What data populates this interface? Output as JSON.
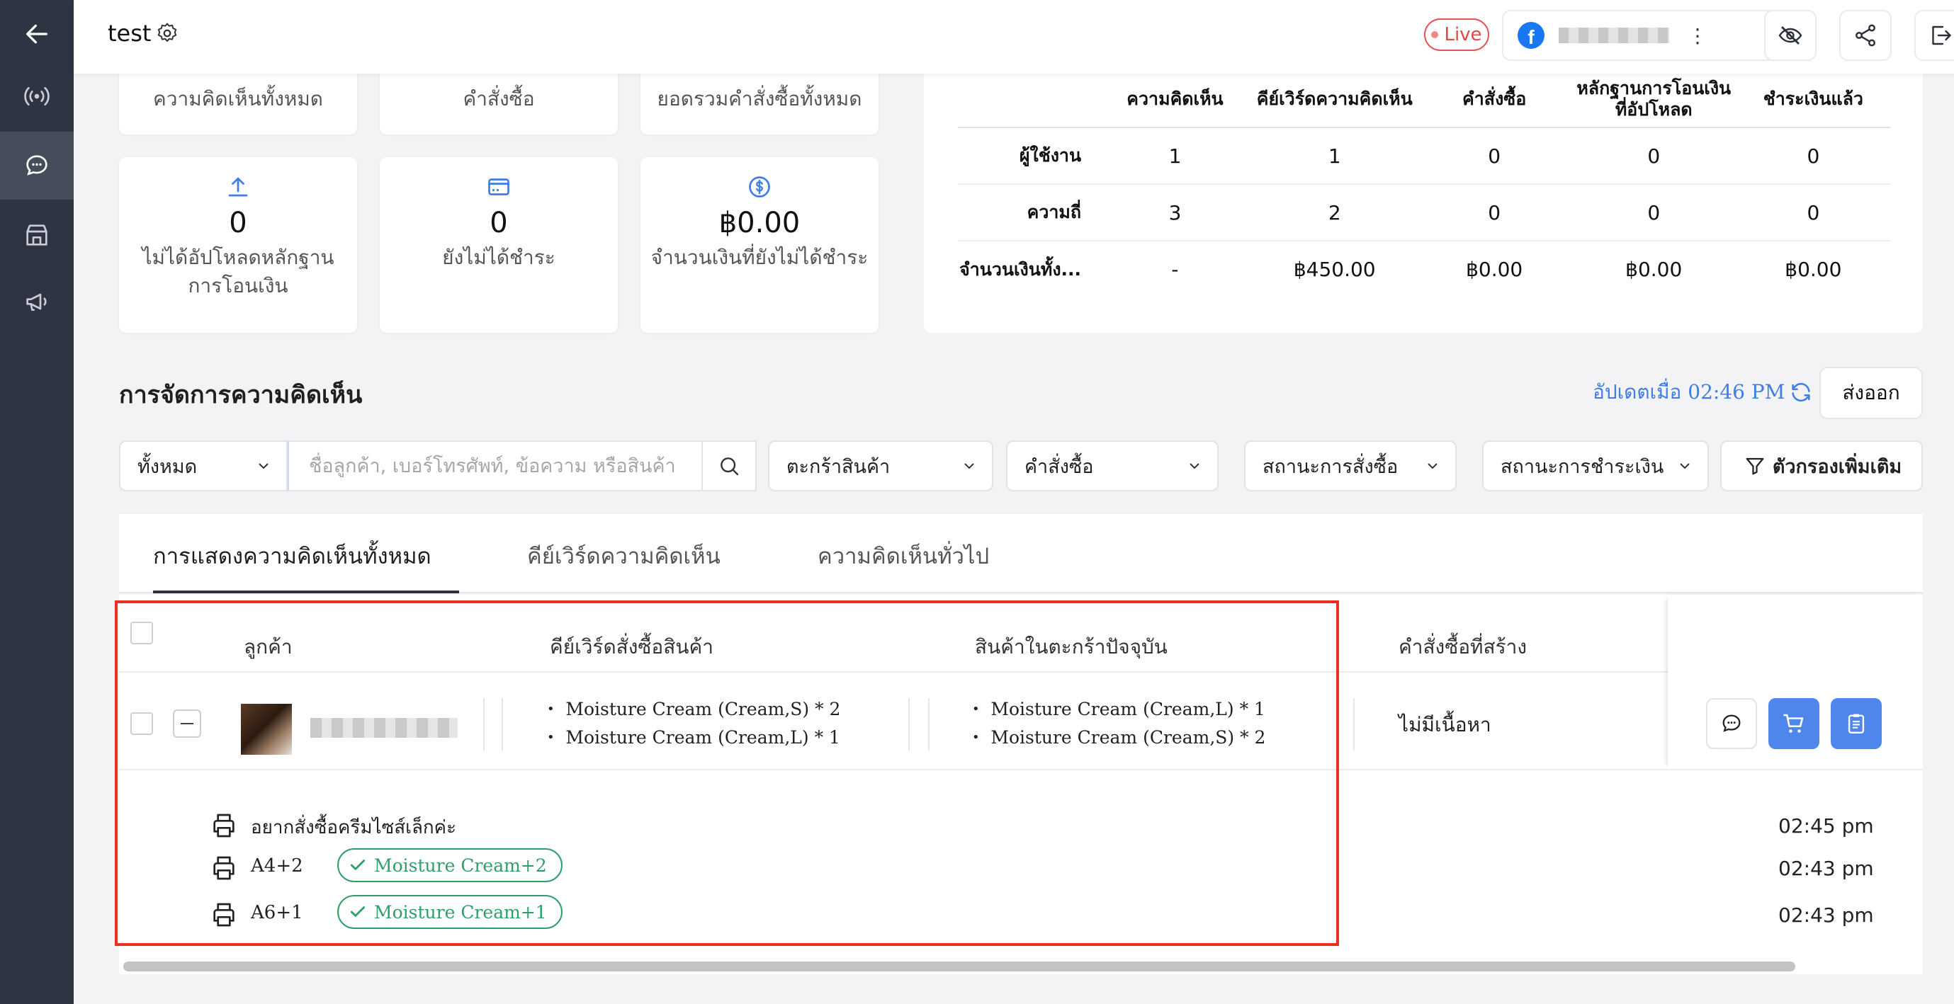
{
  "header": {
    "title": "test",
    "live_label": "Live",
    "fb_account": "(blurred)"
  },
  "stats": {
    "top_labels": [
      "ความคิดเห็นทั้งหมด",
      "คำสั่งซื้อ",
      "ยอดรวมคำสั่งซื้อทั้งหมด"
    ],
    "cards": [
      {
        "value": "0",
        "label_line1": "ไม่ได้อัปโหลดหลักฐาน",
        "label_line2": "การโอนเงิน",
        "icon": "upload-icon"
      },
      {
        "value": "0",
        "label_line1": "ยังไม่ได้ชำระ",
        "label_line2": "",
        "icon": "credit-card-icon"
      },
      {
        "value": "฿0.00",
        "label_line1": "จำนวนเงินที่ยังไม่ได้ชำระ",
        "label_line2": "",
        "icon": "dollar-circle-icon"
      }
    ]
  },
  "summary": {
    "headers": [
      "ความคิดเห็น",
      "คีย์เวิร์ดความคิดเห็น",
      "คำสั่งซื้อ",
      "หลักฐานการโอนเงินที่อัปโหลด",
      "ชำระเงินแล้ว"
    ],
    "rows": [
      {
        "label": "ผู้ใช้งาน",
        "cells": [
          "1",
          "1",
          "0",
          "0",
          "0"
        ]
      },
      {
        "label": "ความถี่",
        "cells": [
          "3",
          "2",
          "0",
          "0",
          "0"
        ]
      },
      {
        "label": "จำนวนเงินทั้ง...",
        "cells": [
          "-",
          "฿450.00",
          "฿0.00",
          "฿0.00",
          "฿0.00"
        ]
      }
    ]
  },
  "section": {
    "title": "การจัดการความคิดเห็น",
    "updated": "อัปเดตเมื่อ 02:46 PM",
    "export": "ส่งออก"
  },
  "filters": {
    "scope": "ทั้งหมด",
    "search_placeholder": "ชื่อลูกค้า, เบอร์โทรศัพท์, ข้อความ หรือสินค้า",
    "cart": "ตะกร้าสินค้า",
    "order": "คำสั่งซื้อ",
    "order_status": "สถานะการสั่งซื้อ",
    "payment_status": "สถานะการชำระเงิน",
    "more": "ตัวกรองเพิ่มเติม"
  },
  "tabs": [
    "การแสดงความคิดเห็นทั้งหมด",
    "คีย์เวิร์ดความคิดเห็น",
    "ความคิดเห็นทั่วไป"
  ],
  "table": {
    "headers": {
      "customer": "ลูกค้า",
      "keywords": "คีย์เวิร์ดสั่งซื้อสินค้า",
      "cart": "สินค้าในตะกร้าปัจจุบัน",
      "orders": "คำสั่งซื้อที่สร้าง"
    },
    "row": {
      "keywords": [
        "Moisture Cream (Cream,S) * 2",
        "Moisture Cream (Cream,L) * 1"
      ],
      "cart": [
        "Moisture Cream (Cream,L) * 1",
        "Moisture Cream (Cream,S) * 2"
      ],
      "orders": "ไม่มีเนื้อหา"
    },
    "comments": [
      {
        "text": "อยากสั่งซื้อครีมไซส์เล็กค่ะ",
        "tag": "",
        "time": "02:45 pm"
      },
      {
        "text": "A4+2",
        "tag": "Moisture Cream+2",
        "time": "02:43 pm"
      },
      {
        "text": "A6+1",
        "tag": "Moisture Cream+1",
        "time": "02:43 pm"
      }
    ]
  },
  "colors": {
    "sidebar": "#2e3442",
    "accent": "#4f86ec",
    "live": "#e04848",
    "tag_green": "#2e9f6a",
    "highlight": "#e8301c"
  }
}
